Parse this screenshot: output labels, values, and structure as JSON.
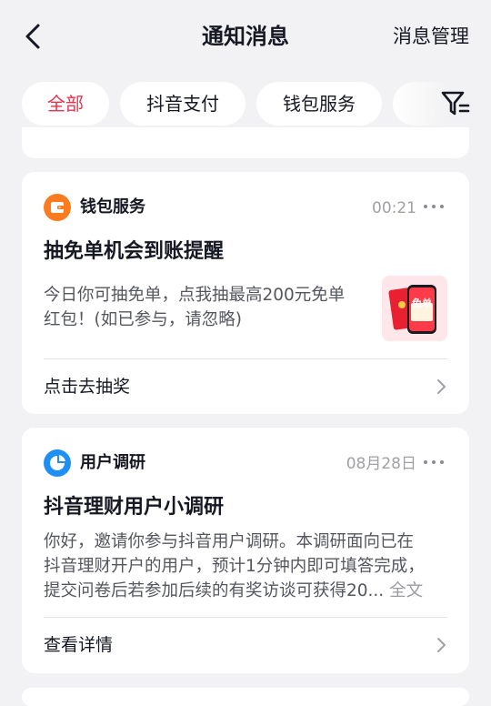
{
  "header": {
    "title": "通知消息",
    "manage_label": "消息管理"
  },
  "tabs": [
    {
      "label": "全部",
      "active": true
    },
    {
      "label": "抖音支付",
      "active": false
    },
    {
      "label": "钱包服务",
      "active": false
    }
  ],
  "notifications": [
    {
      "source": "钱包服务",
      "source_icon": "wallet-icon",
      "icon_color": "#fe7a1e",
      "time": "00:21",
      "title": "抽免单机会到账提醒",
      "body_lines": [
        "今日你可抽免单，点我抽最高200元免单",
        "红包！(如已参与，请忽略)"
      ],
      "thumbnail_text": "免单",
      "action": "点击去抽奖"
    },
    {
      "source": "用户调研",
      "source_icon": "pie-chart-icon",
      "icon_color": "#1e90f5",
      "time": "08月28日",
      "title": "抖音理财用户小调研",
      "body_lines": [
        "你好，邀请你参与抖音用户调研。本调研面向已在",
        "抖音理财开户的用户，预计1分钟内即可填答完成，",
        "提交问卷后若参加后续的有奖访谈可获得20..."
      ],
      "full_text_label": "全文",
      "action": "查看详情"
    }
  ],
  "colors": {
    "accent": "#e8334e",
    "background": "#f2f2f4"
  }
}
